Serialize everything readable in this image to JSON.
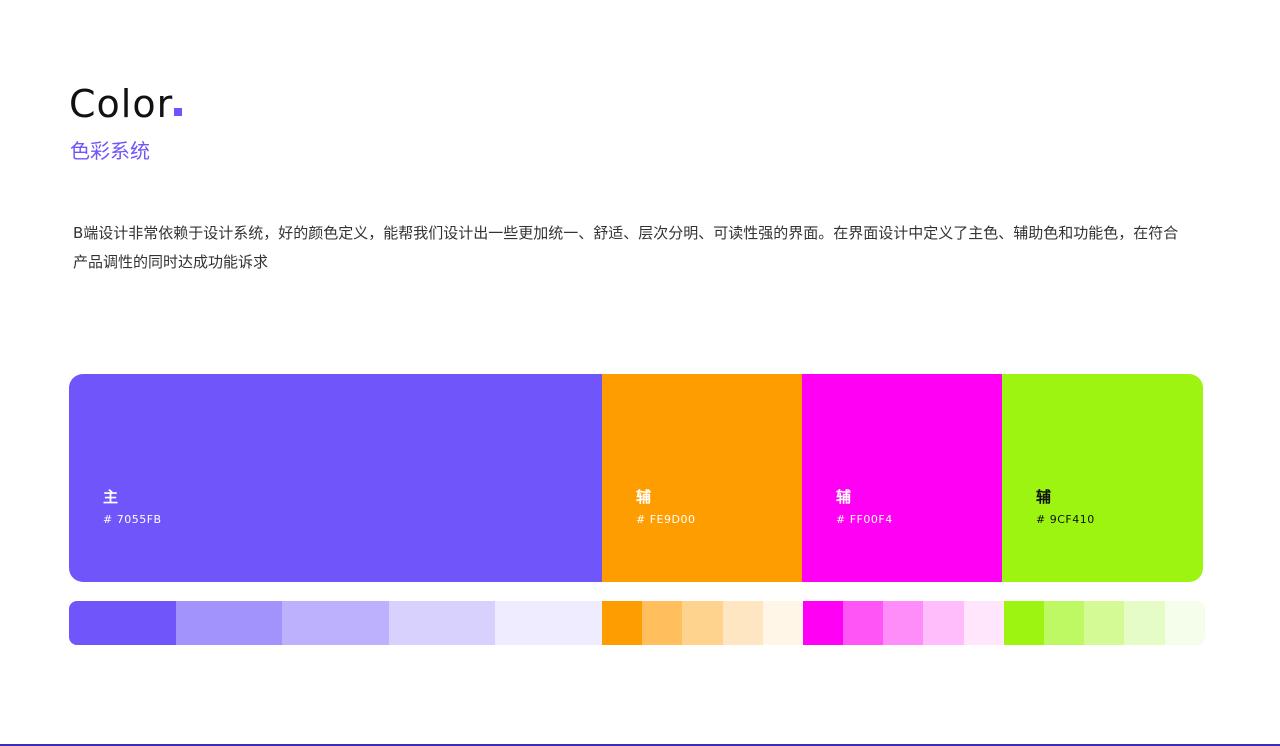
{
  "header": {
    "title": "Color",
    "subtitle": "色彩系统",
    "accent_color": "#7055FB"
  },
  "description": "B端设计非常依赖于设计系统，好的颜色定义，能帮我们设计出一些更加统一、舒适、层次分明、可读性强的界面。在界面设计中定义了主色、辅助色和功能色，在符合产品调性的同时达成功能诉求",
  "swatches": [
    {
      "label": "主",
      "hex": "# 7055FB",
      "color": "#7055FB"
    },
    {
      "label": "辅",
      "hex": "# FE9D00",
      "color": "#FE9D00"
    },
    {
      "label": "辅",
      "hex": "# FF00F4",
      "color": "#FF00F4"
    },
    {
      "label": "辅",
      "hex": "# 9CF410",
      "color": "#9CF410"
    }
  ],
  "tints": {
    "primary": [
      "#7055FB",
      "#A293FC",
      "#BDB1FD",
      "#D8D1FE",
      "#EFECFF"
    ],
    "orange": [
      "#FE9D00",
      "#FEBF5C",
      "#FED38D",
      "#FEE6C2",
      "#FFF6E8"
    ],
    "magenta": [
      "#FF00F4",
      "#FF55F7",
      "#FF8DF9",
      "#FFBEFB",
      "#FFE6FD"
    ],
    "green": [
      "#9CF410",
      "#BEF862",
      "#D4FA96",
      "#E5FCC6",
      "#F4FEEA"
    ]
  }
}
